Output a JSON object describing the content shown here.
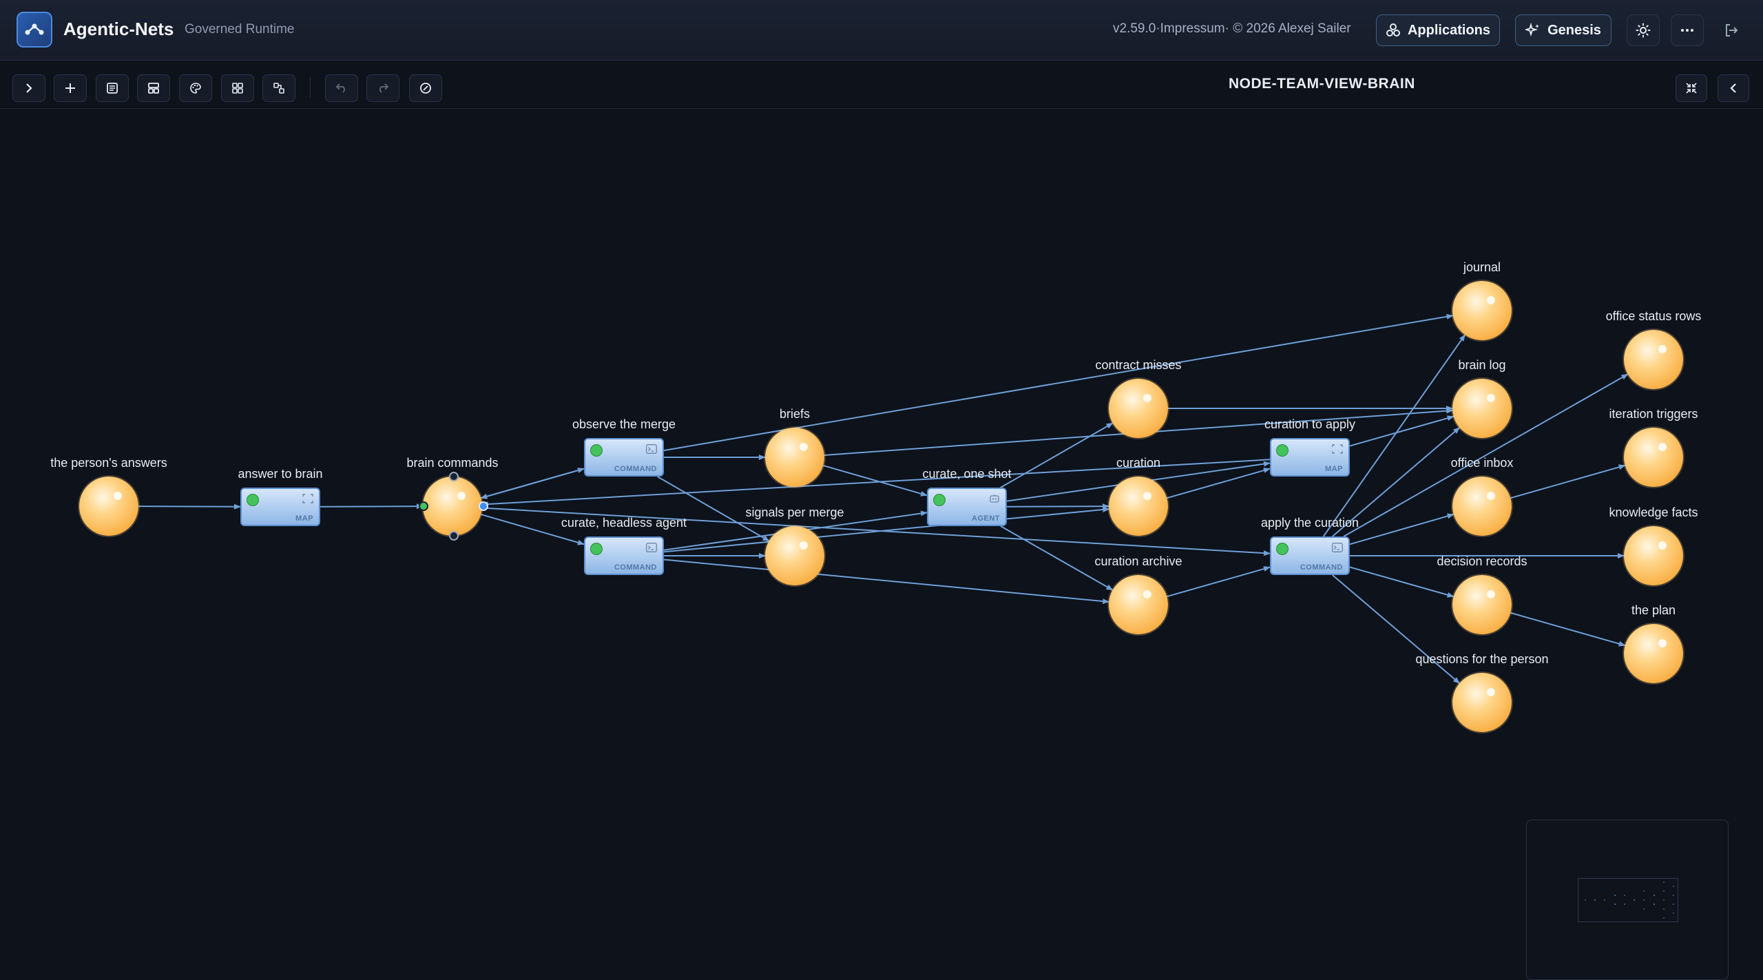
{
  "header": {
    "app_title": "Agentic-Nets",
    "app_subtitle": "Governed Runtime",
    "version_text": "v2.59.0·Impressum· © 2026 Alexej Sailer",
    "applications_label": "Applications",
    "genesis_label": "Genesis"
  },
  "toolbar": {
    "view_title": "NODE-TEAM-VIEW-BRAIN",
    "buttons": [
      "expand-panel",
      "add",
      "list",
      "layout",
      "palette",
      "grid",
      "connect",
      "undo",
      "redo",
      "disable"
    ]
  },
  "accent_colors": {
    "edge": "#6fa0d8",
    "place": "#f9b24a",
    "transition": "#8db6e6",
    "ready_dot": "#44c25c"
  },
  "places": [
    {
      "id": "p_answers",
      "label": "the person's answers"
    },
    {
      "id": "p_brain_commands",
      "label": "brain commands"
    },
    {
      "id": "p_briefs",
      "label": "briefs"
    },
    {
      "id": "p_signals",
      "label": "signals per merge"
    },
    {
      "id": "p_contract_misses",
      "label": "contract misses"
    },
    {
      "id": "p_curation",
      "label": "curation"
    },
    {
      "id": "p_curation_archive",
      "label": "curation archive"
    },
    {
      "id": "p_journal",
      "label": "journal"
    },
    {
      "id": "p_brain_log",
      "label": "brain log"
    },
    {
      "id": "p_office_inbox",
      "label": "office inbox"
    },
    {
      "id": "p_decision_records",
      "label": "decision records"
    },
    {
      "id": "p_questions",
      "label": "questions for the person"
    },
    {
      "id": "p_office_status",
      "label": "office status rows"
    },
    {
      "id": "p_iteration_triggers",
      "label": "iteration triggers"
    },
    {
      "id": "p_knowledge_facts",
      "label": "knowledge facts"
    },
    {
      "id": "p_the_plan",
      "label": "the plan"
    }
  ],
  "transitions": [
    {
      "id": "t_answer_to_brain",
      "label": "answer to brain",
      "kind": "MAP"
    },
    {
      "id": "t_observe",
      "label": "observe the merge",
      "kind": "COMMAND"
    },
    {
      "id": "t_headless",
      "label": "curate, headless agent",
      "kind": "COMMAND"
    },
    {
      "id": "t_one_shot",
      "label": "curate, one shot",
      "kind": "AGENT"
    },
    {
      "id": "t_curation_apply",
      "label": "curation to apply",
      "kind": "MAP"
    },
    {
      "id": "t_apply",
      "label": "apply the curation",
      "kind": "COMMAND"
    }
  ],
  "arcs": [
    [
      "p_answers",
      "t_answer_to_brain"
    ],
    [
      "t_answer_to_brain",
      "p_brain_commands"
    ],
    [
      "p_brain_commands",
      "t_observe"
    ],
    [
      "t_observe",
      "p_brain_commands"
    ],
    [
      "p_brain_commands",
      "t_headless"
    ],
    [
      "p_brain_commands",
      "t_apply"
    ],
    [
      "t_observe",
      "p_briefs"
    ],
    [
      "t_observe",
      "p_journal"
    ],
    [
      "t_observe",
      "p_signals"
    ],
    [
      "t_headless",
      "p_signals"
    ],
    [
      "t_headless",
      "p_curation"
    ],
    [
      "t_headless",
      "p_curation_archive"
    ],
    [
      "t_headless",
      "t_one_shot"
    ],
    [
      "p_briefs",
      "t_one_shot"
    ],
    [
      "p_briefs",
      "p_brain_log"
    ],
    [
      "t_one_shot",
      "p_contract_misses"
    ],
    [
      "t_one_shot",
      "p_curation"
    ],
    [
      "t_one_shot",
      "p_curation_archive"
    ],
    [
      "t_one_shot",
      "t_curation_apply"
    ],
    [
      "p_contract_misses",
      "p_brain_log"
    ],
    [
      "p_curation",
      "t_curation_apply"
    ],
    [
      "p_curation_archive",
      "t_apply"
    ],
    [
      "t_curation_apply",
      "p_brain_commands"
    ],
    [
      "t_curation_apply",
      "p_brain_log"
    ],
    [
      "t_apply",
      "p_journal"
    ],
    [
      "t_apply",
      "p_brain_log"
    ],
    [
      "t_apply",
      "p_office_inbox"
    ],
    [
      "t_apply",
      "p_decision_records"
    ],
    [
      "t_apply",
      "p_questions"
    ],
    [
      "t_apply",
      "p_office_status"
    ],
    [
      "t_apply",
      "p_knowledge_facts"
    ],
    [
      "p_office_inbox",
      "p_iteration_triggers"
    ],
    [
      "p_decision_records",
      "p_the_plan"
    ]
  ]
}
